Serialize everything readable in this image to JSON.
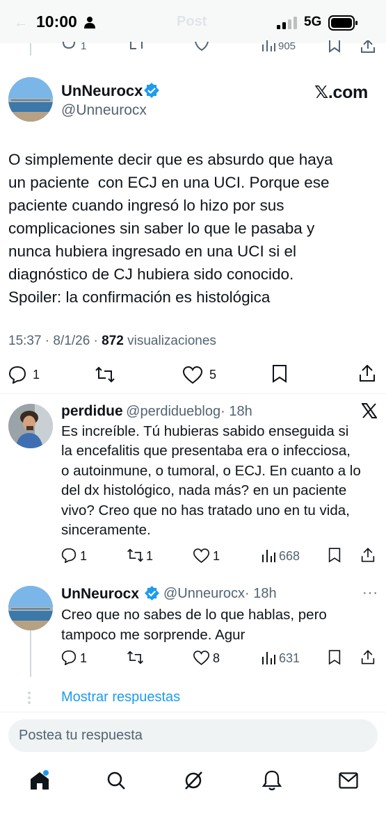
{
  "status_bar": {
    "time": "10:00",
    "network": "5G",
    "faded_title": "Post"
  },
  "prev_tweet_actions": {
    "replies": "1",
    "views": "905"
  },
  "main_tweet": {
    "author_name": "UnNeurocx",
    "author_handle": "@Unneurocx",
    "source": "𝕏.com",
    "text": "O simplemente decir que es absurdo que haya\nun paciente  con ECJ en una UCI. Porque ese\npaciente cuando ingresó lo hizo por sus\ncomplicaciones sin saber lo que le pasaba y\nnunca hubiera ingresado en una UCI si el\ndiagnóstico de CJ hubiera sido conocido.\nSpoiler: la confirmación es histológica",
    "timestamp": "15:37 · 8/1/26 · ",
    "views": "872",
    "views_label": " visualizaciones",
    "replies": "1",
    "likes": "5"
  },
  "replies": [
    {
      "author_name": "perdidue",
      "author_handle": "@perdidueblog",
      "time": "· 18h",
      "text": "Es increíble. Tú hubieras sabido enseguida si\nla encefalitis que presentaba era o infecciosa,\no autoinmune, o tumoral, o ECJ. En cuanto a lo\ndel dx histológico, nada más? en un paciente\nvivo? Creo que no has tratado uno en tu vida,\nsinceramente.",
      "replies": "1",
      "reposts": "1",
      "likes": "1",
      "views": "668"
    },
    {
      "author_name": "UnNeurocx",
      "author_handle": "@Unneurocx",
      "time": "· 18h",
      "text": "Creo que no sabes de lo que hablas, pero\ntampoco me sorprende. Agur",
      "replies": "1",
      "likes": "8",
      "views": "631"
    }
  ],
  "show_replies_label": "Mostrar respuestas",
  "composer": {
    "placeholder": "Postea tu respuesta"
  },
  "colors": {
    "accent": "#1d9bf0",
    "muted": "#536471",
    "text": "#0f1419"
  }
}
